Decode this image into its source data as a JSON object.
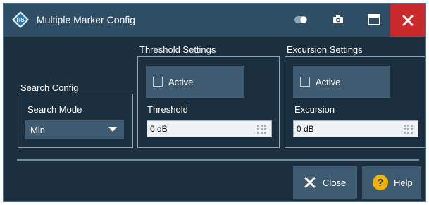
{
  "window": {
    "title": "Multiple Marker Config",
    "icons": [
      "app-logo-icon",
      "toggle-icon",
      "camera-icon",
      "maximize-icon",
      "close-icon"
    ],
    "colors": {
      "background": "#1b2f3e",
      "titlebar": "#2e4e66",
      "close": "#c9292a",
      "control": "#3f5b71"
    }
  },
  "search_config": {
    "group_label": "Search Config",
    "mode_label": "Search Mode",
    "mode_value": "Min"
  },
  "threshold": {
    "group_label": "Threshold Settings",
    "active_label": "Active",
    "active_checked": false,
    "field_label": "Threshold",
    "value": "0 dB"
  },
  "excursion": {
    "group_label": "Excursion Settings",
    "active_label": "Active",
    "active_checked": false,
    "field_label": "Excursion",
    "value": "0 dB"
  },
  "buttons": {
    "close_label": "Close",
    "help_label": "Help"
  }
}
